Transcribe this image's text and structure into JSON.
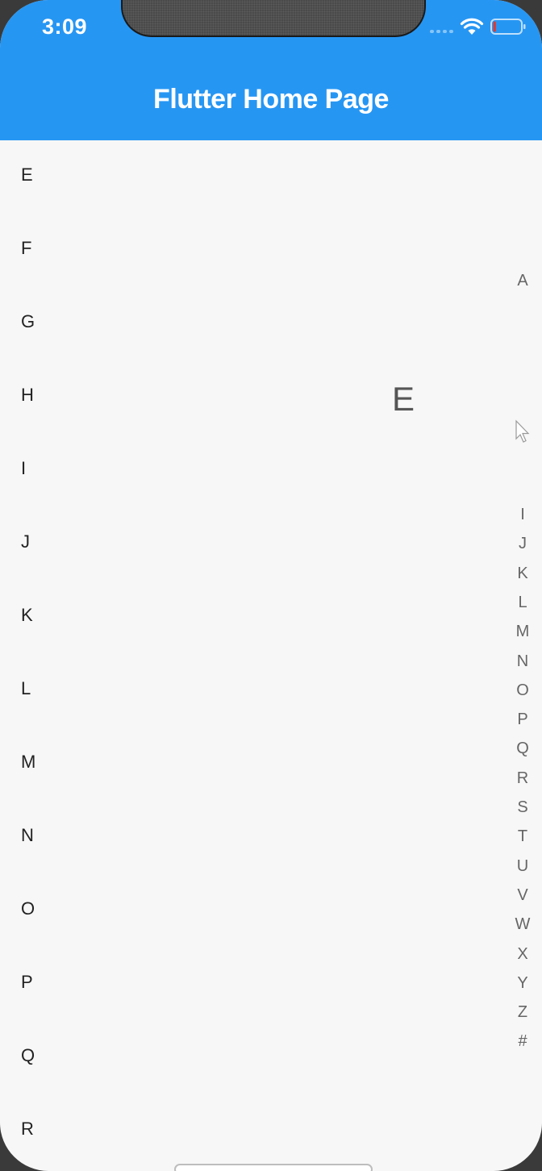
{
  "status_bar": {
    "time": "3:09",
    "wifi_icon": "wifi-icon",
    "battery_icon": "battery-icon",
    "battery_level_fraction": 0.1
  },
  "app_bar": {
    "title": "Flutter Home Page",
    "color": "#2696f3"
  },
  "list": {
    "items": [
      "E",
      "F",
      "G",
      "H",
      "I",
      "J",
      "K",
      "L",
      "M",
      "N",
      "O",
      "P",
      "Q",
      "R"
    ]
  },
  "bubble": {
    "letter": "E"
  },
  "index_bar": {
    "letters": [
      "A",
      "I",
      "J",
      "K",
      "L",
      "M",
      "N",
      "O",
      "P",
      "Q",
      "R",
      "S",
      "T",
      "U",
      "V",
      "W",
      "X",
      "Y",
      "Z",
      "#"
    ]
  },
  "colors": {
    "background": "#f7f7f7",
    "text": "#222222",
    "index_text": "#666666"
  }
}
